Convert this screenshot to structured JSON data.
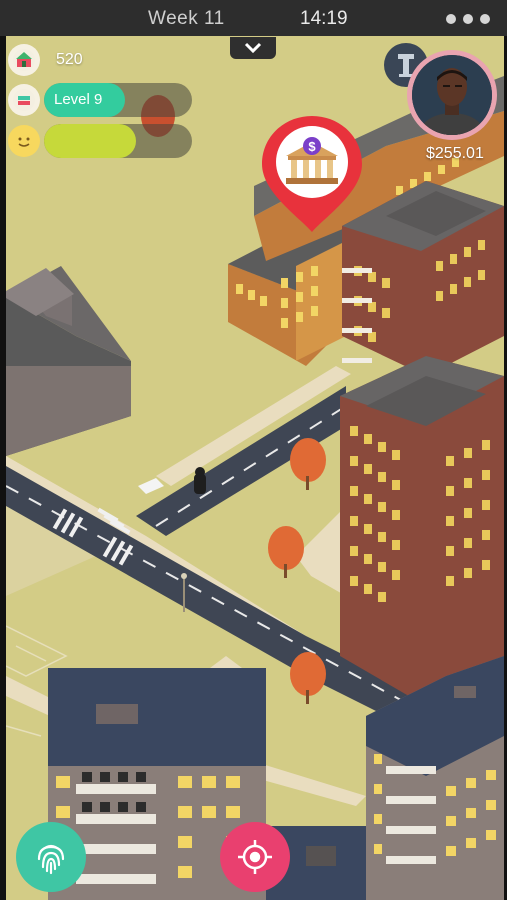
{
  "status_bar": {
    "week_label": "Week 11",
    "time": "14:19",
    "menu_icon": "more-dots-icon"
  },
  "hud": {
    "points": "520",
    "level_label": "Level 9",
    "level_progress": 0.55,
    "mood_progress": 0.62,
    "money": "$255.01",
    "collapse_icon": "chevron-down-icon",
    "tower_icon": "tower-icon"
  },
  "map": {
    "marker_icon": "bank-icon",
    "marker_color": "#e8323c"
  },
  "buttons": {
    "fingerprint_icon": "fingerprint-icon",
    "locate_icon": "crosshair-icon"
  },
  "colors": {
    "grass": "#d3cc86",
    "road": "#3f4654",
    "level_bar": "#33cc9e",
    "mood_bar": "#c6d93a",
    "accent_pink": "#e9406f",
    "accent_teal": "#3fc6a4"
  }
}
